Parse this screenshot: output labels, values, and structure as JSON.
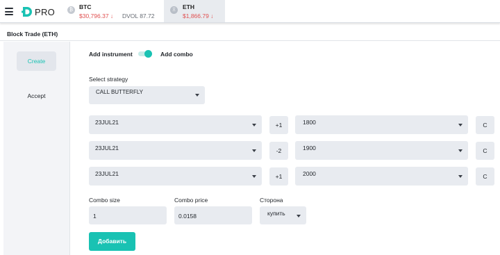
{
  "header": {
    "logo_text": "PRO",
    "tickers": [
      {
        "name": "BTC",
        "price": "$30,796.37 ↓",
        "dvol": "DVOL 87.72",
        "icon": "bitcoin-icon"
      },
      {
        "name": "ETH",
        "price": "$1,866.79 ↓",
        "icon": "ethereum-icon"
      }
    ]
  },
  "page": {
    "title": "Block Trade (ETH)"
  },
  "sidebar": {
    "items": [
      {
        "label": "Create",
        "active": true
      },
      {
        "label": "Accept",
        "active": false
      }
    ]
  },
  "form": {
    "add_instrument_label": "Add instrument",
    "add_combo_label": "Add combo",
    "toggle_on": true,
    "strategy_label": "Select strategy",
    "strategy_value": "CALL BUTTERFLY",
    "legs": [
      {
        "expiry": "23JUL21",
        "ratio": "+1",
        "strike": "1800",
        "type": "C"
      },
      {
        "expiry": "23JUL21",
        "ratio": "-2",
        "strike": "1900",
        "type": "C"
      },
      {
        "expiry": "23JUL21",
        "ratio": "+1",
        "strike": "2000",
        "type": "C"
      }
    ],
    "combo_size_label": "Combo size",
    "combo_size_value": "1",
    "combo_price_label": "Combo price",
    "combo_price_value": "0.0158",
    "side_label": "Сторона",
    "side_value": "купить",
    "submit_label": "Добавить"
  },
  "colors": {
    "accent": "#19c2b3",
    "price_down": "#e05050",
    "field_bg": "#e8ebf0"
  }
}
